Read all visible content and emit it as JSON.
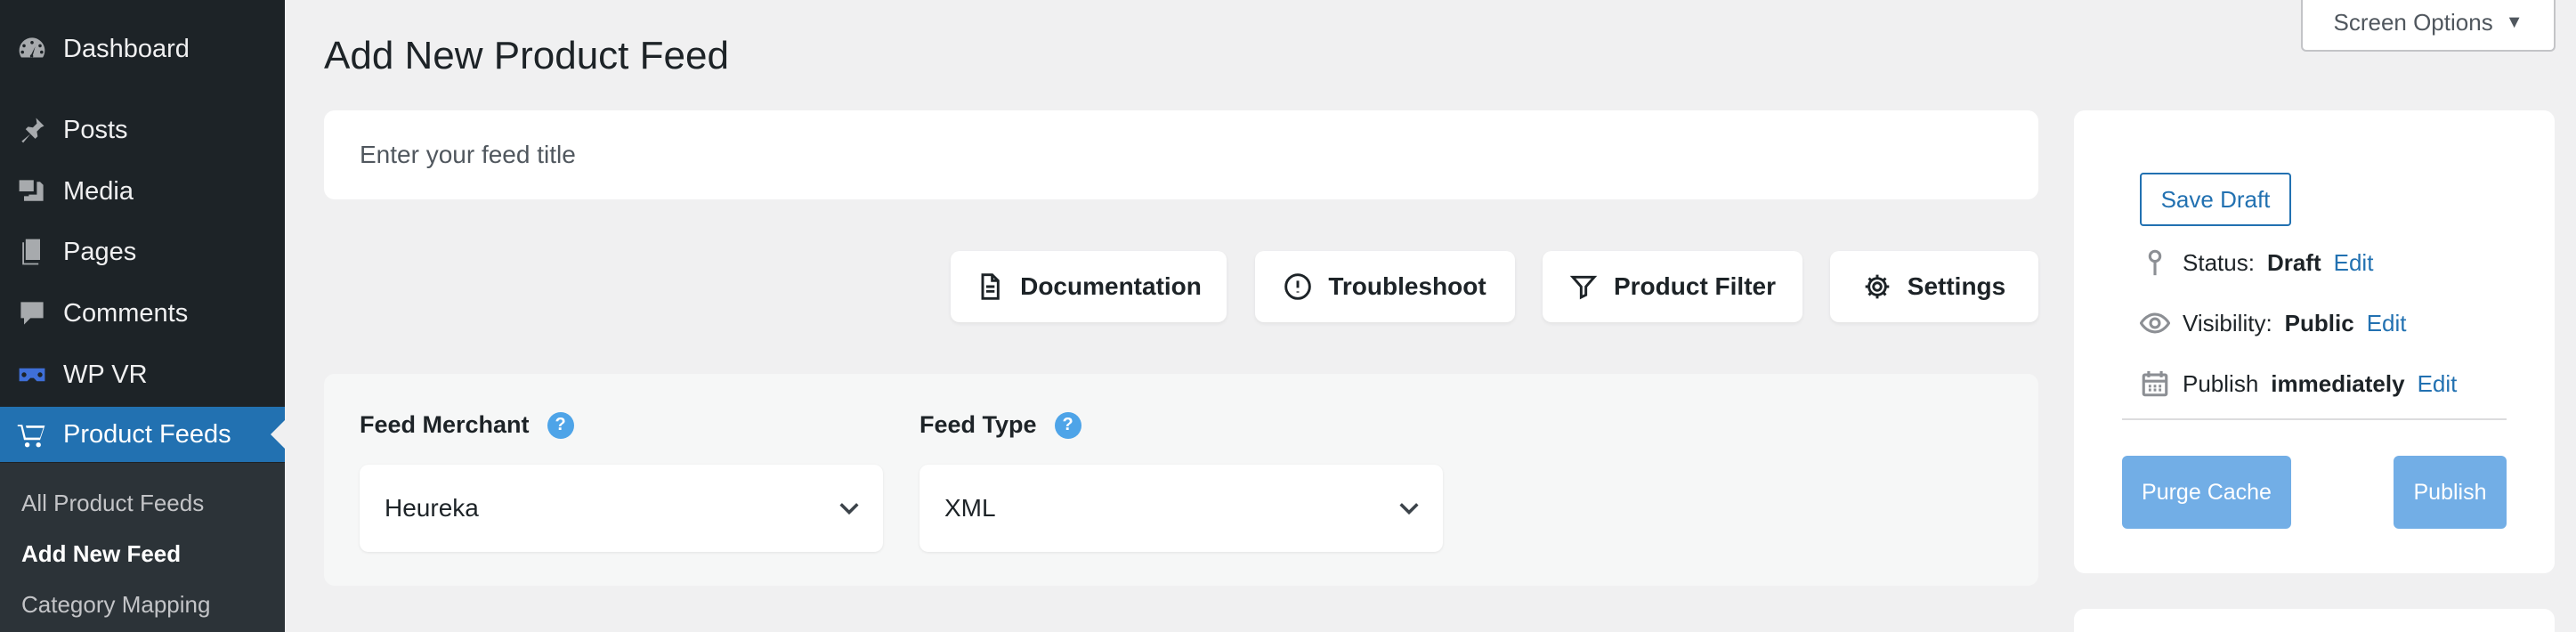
{
  "sidebar": {
    "items": [
      {
        "label": "Dashboard",
        "icon": "dashboard-icon"
      },
      {
        "label": "Posts",
        "icon": "pin-icon"
      },
      {
        "label": "Media",
        "icon": "media-icon"
      },
      {
        "label": "Pages",
        "icon": "pages-icon"
      },
      {
        "label": "Comments",
        "icon": "comment-icon"
      },
      {
        "label": "WP VR",
        "icon": "vr-icon"
      },
      {
        "label": "Product Feeds",
        "icon": "cart-icon"
      }
    ],
    "submenu": [
      "All Product Feeds",
      "Add New Feed",
      "Category Mapping"
    ],
    "accent_color": "#2271b1"
  },
  "screen_options": {
    "label": "Screen Options"
  },
  "page_title": "Add New Product Feed",
  "title_field": {
    "placeholder": "Enter your feed title",
    "value": ""
  },
  "toolbar": {
    "documentation": "Documentation",
    "troubleshoot": "Troubleshoot",
    "product_filter": "Product Filter",
    "settings": "Settings"
  },
  "feed_form": {
    "merchant_label": "Feed Merchant",
    "merchant_value": "Heureka",
    "type_label": "Feed Type",
    "type_value": "XML",
    "help_glyph": "?"
  },
  "publish": {
    "save_draft": "Save Draft",
    "status_label": "Status:",
    "status_value": "Draft",
    "visibility_label": "Visibility:",
    "visibility_value": "Public",
    "publish_label": "Publish",
    "publish_value": "immediately",
    "edit": "Edit",
    "purge_cache": "Purge Cache",
    "publish_button": "Publish",
    "button_color": "#72aee6"
  }
}
